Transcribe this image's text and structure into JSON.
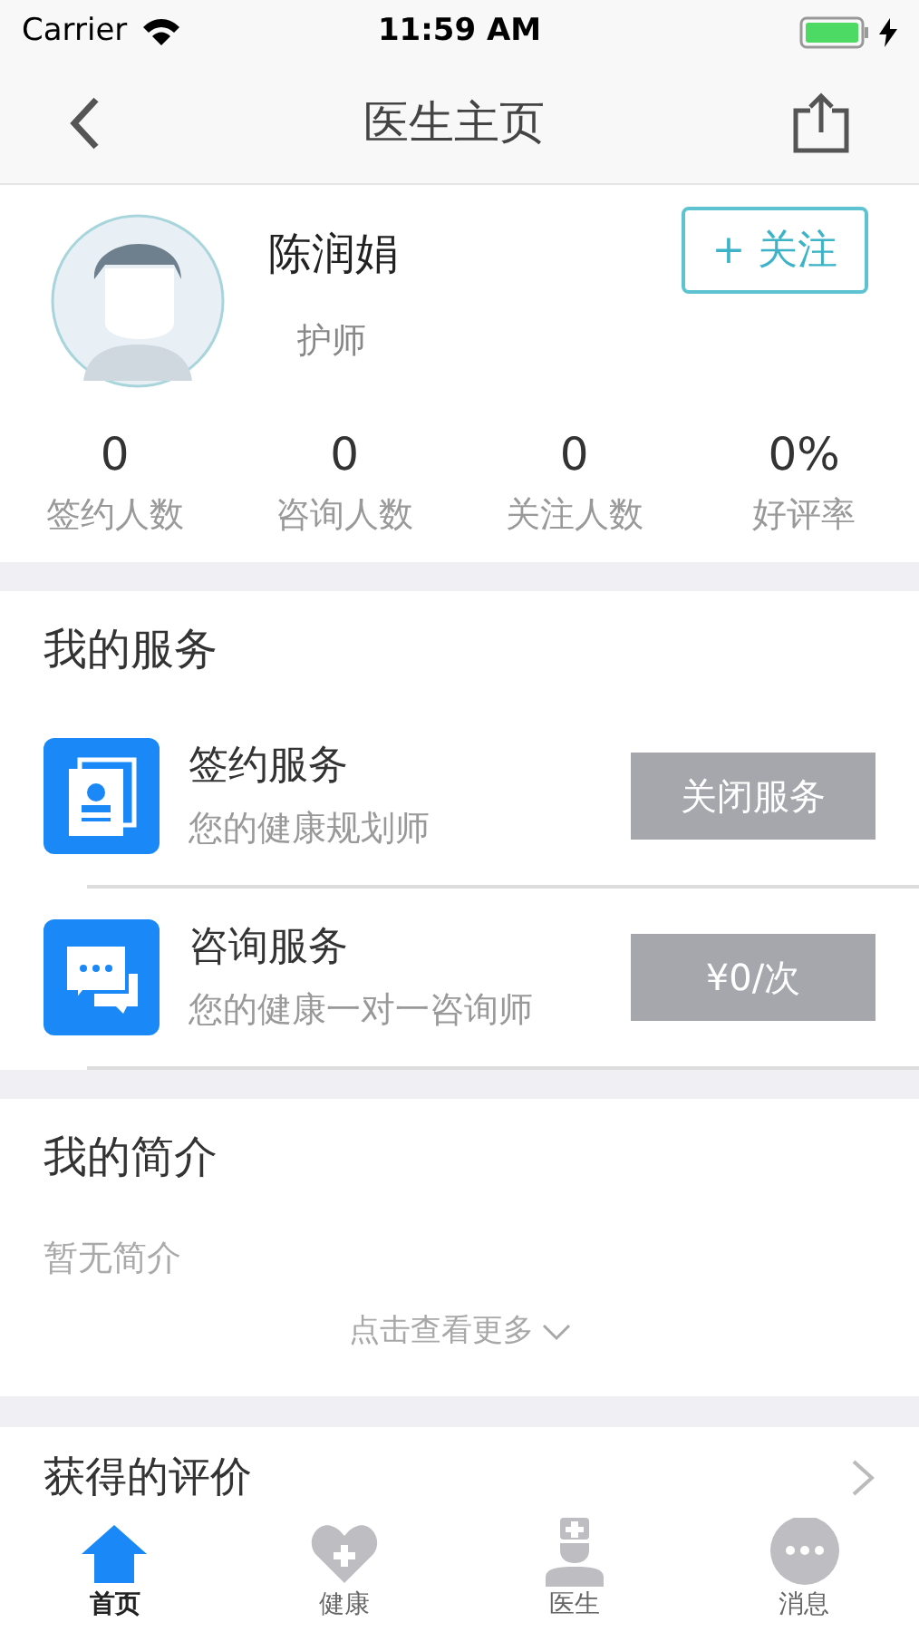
{
  "status_bar": {
    "carrier": "Carrier",
    "time": "11:59 AM"
  },
  "nav": {
    "title": "医生主页"
  },
  "profile": {
    "name": "陈润娟",
    "role": "护师",
    "follow_button": "+ 关注"
  },
  "stats": [
    {
      "value": "0",
      "label": "签约人数"
    },
    {
      "value": "0",
      "label": "咨询人数"
    },
    {
      "value": "0",
      "label": "关注人数"
    },
    {
      "value": "0%",
      "label": "好评率"
    }
  ],
  "services": {
    "title": "我的服务",
    "items": [
      {
        "kind": "contract",
        "name": "签约服务",
        "description": "您的健康规划师",
        "action": "关闭服务"
      },
      {
        "kind": "chat",
        "name": "咨询服务",
        "description": "您的健康一对一咨询师",
        "action": "¥0/次"
      }
    ]
  },
  "intro": {
    "title": "我的简介",
    "text": "暂无简介",
    "more": "点击查看更多"
  },
  "reviews": {
    "title": "获得的评价"
  },
  "tab_bar": [
    {
      "kind": "home",
      "label": "首页",
      "selected": true
    },
    {
      "kind": "health",
      "label": "健康",
      "selected": false
    },
    {
      "kind": "doctor",
      "label": "医生",
      "selected": false
    },
    {
      "kind": "message",
      "label": "消息",
      "selected": false
    }
  ]
}
